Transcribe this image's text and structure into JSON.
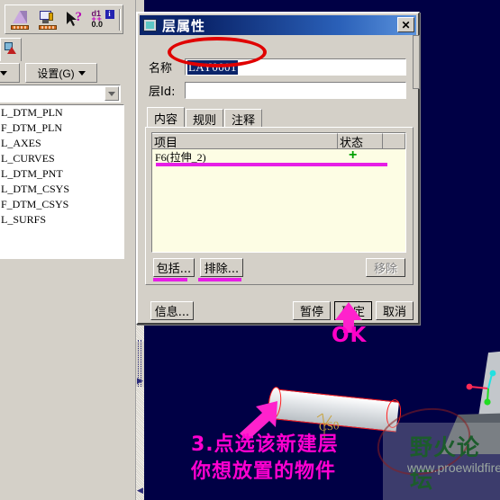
{
  "app": {
    "viewport_bg": "#000045",
    "chrome_bg": "#d4d0c8"
  },
  "toolbar": {
    "icons": [
      {
        "name": "prism-measure-icon",
        "tip": "prism-with-ruler"
      },
      {
        "name": "screen-measure-icon",
        "tip": "monitor-with-ruler"
      },
      {
        "name": "cursor-query-icon",
        "tip": "pointer-question"
      },
      {
        "name": "dimension-info-icon",
        "tip": "d1-00-info"
      }
    ],
    "d1_label": "d1",
    "zero_label": "0.0",
    "info_label": "i"
  },
  "left_panel": {
    "menu_buttons": [
      {
        "label": "",
        "name": "view-menu-button"
      },
      {
        "label": "设置(G)",
        "name": "settings-menu-button"
      }
    ],
    "combo_value": "",
    "tree_items": [
      "L_DTM_PLN",
      "F_DTM_PLN",
      "L_AXES",
      "L_CURVES",
      "L_DTM_PNT",
      "L_DTM_CSYS",
      "F_DTM_CSYS",
      "L_SURFS"
    ]
  },
  "dialog": {
    "title": "层属性",
    "close_label": "✕",
    "fields": [
      {
        "label": "名称",
        "value": "LAY0001",
        "selected": true,
        "name": "layer-name-field"
      },
      {
        "label": "层Id:",
        "value": "",
        "selected": false,
        "name": "layer-id-field"
      }
    ],
    "tabs": [
      {
        "label": "内容",
        "active": true
      },
      {
        "label": "规则",
        "active": false
      },
      {
        "label": "注释",
        "active": false
      }
    ],
    "list": {
      "columns": [
        "项目",
        "状态",
        ""
      ],
      "rows": [
        {
          "item": "F6(拉伸_2)",
          "status": "+",
          "status_color": "#00a000"
        }
      ]
    },
    "list_buttons": [
      {
        "label": "包括...",
        "name": "include-button",
        "disabled": false
      },
      {
        "label": "排除...",
        "name": "exclude-button",
        "disabled": false
      },
      {
        "label": "移除",
        "name": "remove-button",
        "disabled": true
      }
    ],
    "footer_buttons": [
      {
        "label": "信息...",
        "name": "info-button",
        "disabled": false,
        "default": false
      },
      {
        "label": "暂停",
        "name": "pause-button",
        "disabled": false,
        "default": false
      },
      {
        "label": "确定",
        "name": "ok-button",
        "disabled": false,
        "default": true
      },
      {
        "label": "取消",
        "name": "cancel-button",
        "disabled": false,
        "default": false
      }
    ]
  },
  "annotations": {
    "highlight_color": "#ff00d0",
    "ellipse_color": "#e00000",
    "ok_label": "OK",
    "step_number": "3.",
    "step_line1": "点选该新建层",
    "step_line2": "你想放置的物件"
  },
  "model": {
    "csys_label": "CS0",
    "triad_axes": [
      {
        "name": "x-axis",
        "color": "#ff2a55"
      },
      {
        "name": "y-axis",
        "color": "#22e0e0"
      },
      {
        "name": "z-axis",
        "color": "#22dd22"
      }
    ]
  },
  "watermark": {
    "forum": "野火论坛",
    "url": "www.proewildfire.cn"
  }
}
